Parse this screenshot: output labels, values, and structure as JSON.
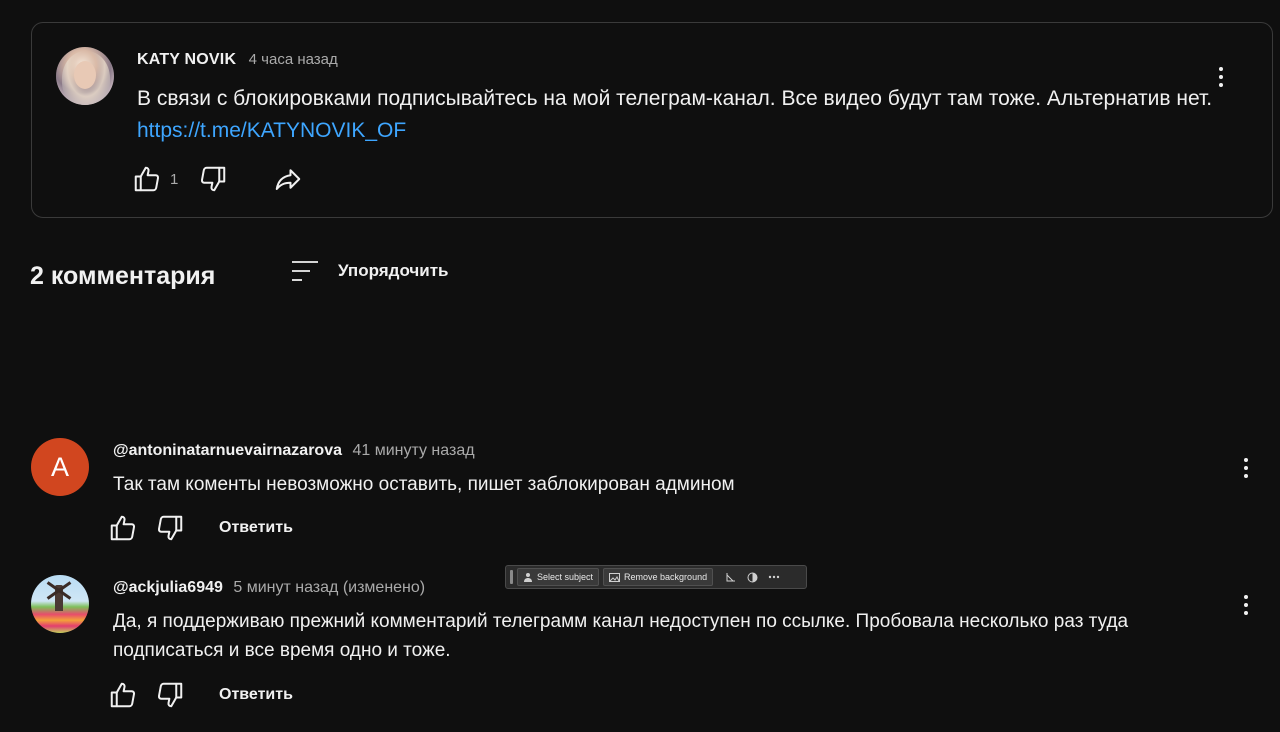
{
  "post": {
    "author": "KATY NOVIK",
    "time": "4 часа назад",
    "text": "В связи с блокировками подписывайтесь на мой телеграм-канал. Все видео будут там тоже. Альтернатив нет.",
    "link": "https://t.me/KATYNOVIK_OF",
    "likes": "1",
    "icons": {
      "like": "thumbs-up-icon",
      "dislike": "thumbs-down-icon",
      "share": "share-arrow-icon",
      "menu": "more-vert-icon"
    }
  },
  "comments_header": {
    "count_label": "2 комментария",
    "sort_label": "Упорядочить",
    "sort_icon": "sort-lines-icon"
  },
  "comments": [
    {
      "avatar_letter": "A",
      "avatar_color": "#d1461f",
      "author": "@antoninatarnuevairnazarova",
      "time": "41 минуту назад",
      "text": "Так там коменты невозможно оставить, пишет заблокирован админом",
      "reply_label": "Ответить"
    },
    {
      "avatar_letter": "",
      "author": "@ackjulia6949",
      "time": "5 минут назад (изменено)",
      "text": "Да, я поддерживаю прежний комментарий телеграмм канал недоступен по ссылке. Пробовала несколько раз туда подписаться и все время одно и тоже.",
      "reply_label": "Ответить"
    }
  ],
  "image_toolbar": {
    "select_subject": "Select subject",
    "remove_background": "Remove background",
    "icons": [
      "person-select-icon",
      "image-icon",
      "crop-paint-icon",
      "contrast-icon",
      "more-horiz-icon"
    ]
  },
  "colors": {
    "background": "#0f0f0f",
    "text": "#f1f1f1",
    "secondary_text": "#aaaaaa",
    "link": "#3ea6ff",
    "card_border": "#3a3a3a"
  }
}
